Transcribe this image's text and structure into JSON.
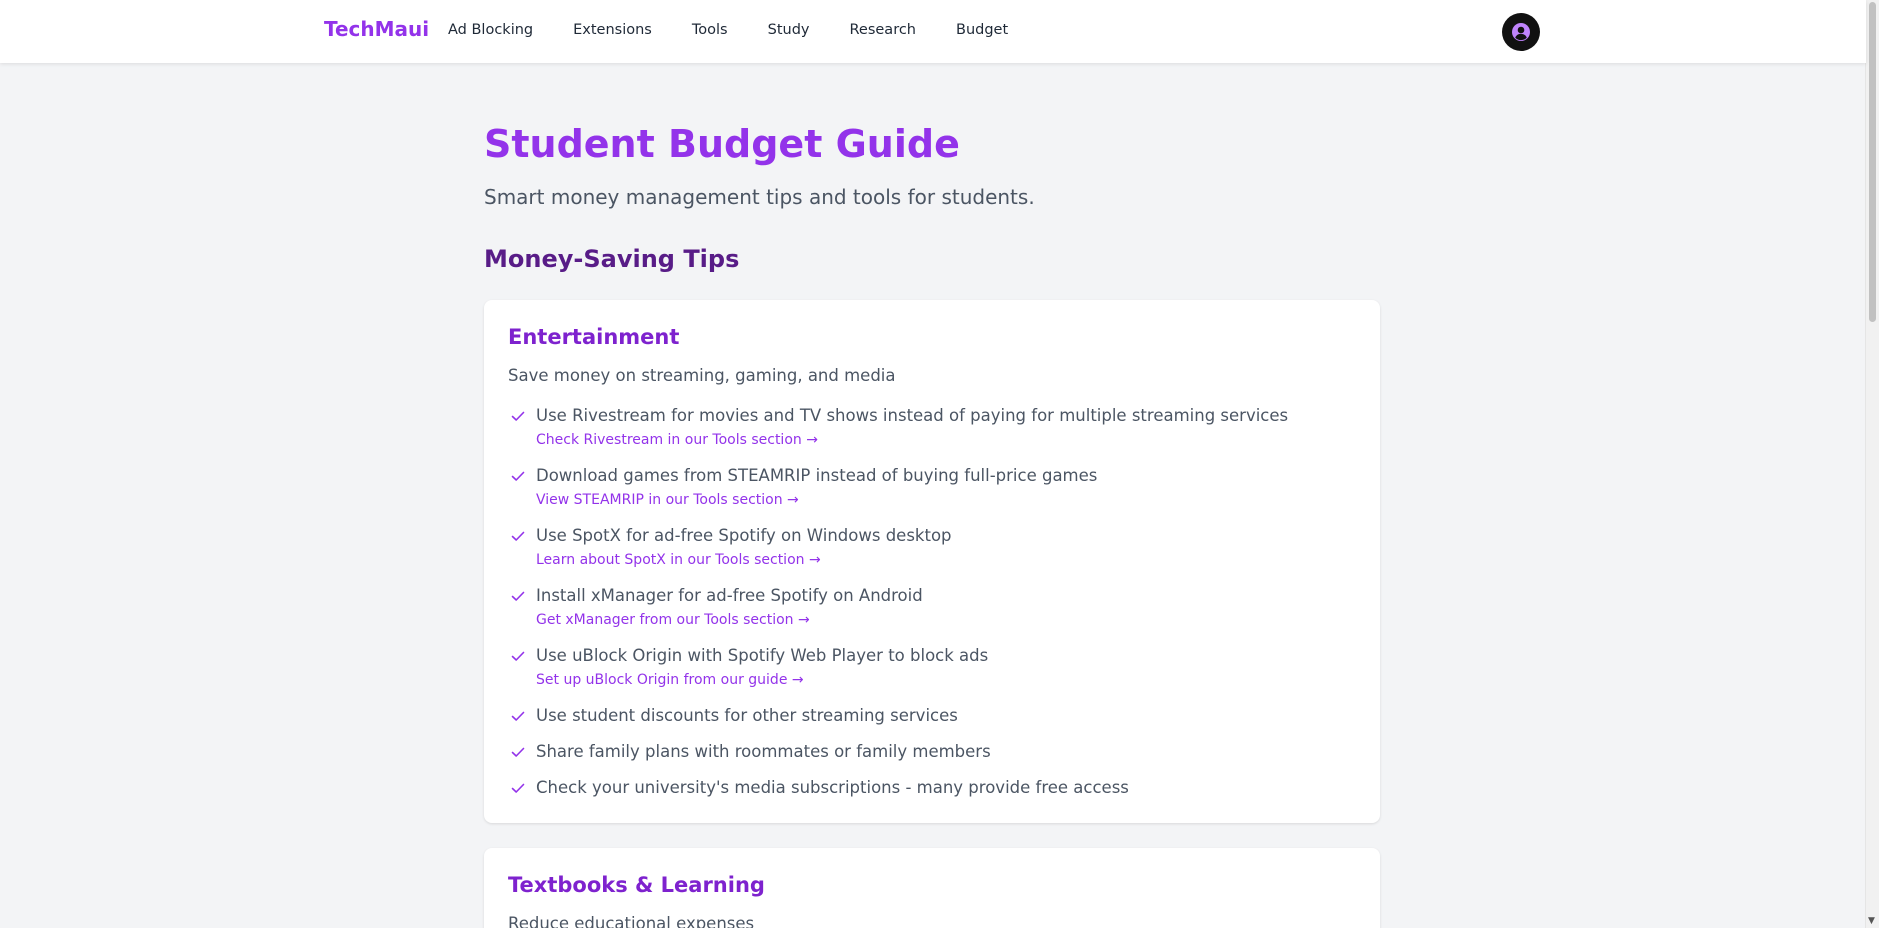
{
  "nav": {
    "brand": "TechMaui",
    "links": [
      "Ad Blocking",
      "Extensions",
      "Tools",
      "Study",
      "Research",
      "Budget"
    ],
    "avatar_icon": "user-circle-icon"
  },
  "page": {
    "title": "Student Budget Guide",
    "subtitle": "Smart money management tips and tools for students.",
    "section_title": "Money-Saving Tips"
  },
  "cards": [
    {
      "title": "Entertainment",
      "description": "Save money on streaming, gaming, and media",
      "tips": [
        {
          "text": "Use Rivestream for movies and TV shows instead of paying for multiple streaming services",
          "link": "Check Rivestream in our Tools section →"
        },
        {
          "text": "Download games from STEAMRIP instead of buying full-price games",
          "link": "View STEAMRIP in our Tools section →"
        },
        {
          "text": "Use SpotX for ad-free Spotify on Windows desktop",
          "link": "Learn about SpotX in our Tools section →"
        },
        {
          "text": "Install xManager for ad-free Spotify on Android",
          "link": "Get xManager from our Tools section →"
        },
        {
          "text": "Use uBlock Origin with Spotify Web Player to block ads",
          "link": "Set up uBlock Origin from our guide →"
        },
        {
          "text": "Use student discounts for other streaming services"
        },
        {
          "text": "Share family plans with roommates or family members"
        },
        {
          "text": "Check your university's media subscriptions - many provide free access"
        }
      ]
    },
    {
      "title": "Textbooks & Learning",
      "description": "Reduce educational expenses"
    }
  ],
  "colors": {
    "accent": "#9333ea",
    "heading_dark": "#581c87",
    "card_title": "#7e22ce",
    "background": "#f3f4f6"
  }
}
